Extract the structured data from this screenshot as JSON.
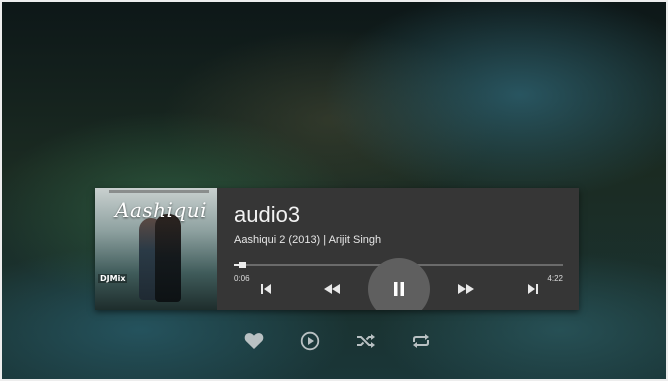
{
  "track": {
    "title": "audio3",
    "subtitle": "Aashiqui 2 (2013) | Arijit Singh"
  },
  "album_art": {
    "logo_text": "Aashiqui",
    "badge_text": "DJMix"
  },
  "playback": {
    "elapsed": "0:06",
    "duration": "4:22",
    "progress_fraction": 0.023,
    "state": "playing"
  },
  "controls": [
    "skip-previous-icon",
    "rewind-icon",
    "pause-icon",
    "fast-forward-icon",
    "skip-next-icon"
  ],
  "bottom_actions": [
    "heart-icon",
    "play-circle-icon",
    "shuffle-icon",
    "repeat-icon"
  ],
  "colors": {
    "panel": "#363636",
    "pause_circle": "#5f5f5f",
    "icon": "#e8e8e8",
    "bottom_icon": "#b9c1c3"
  }
}
